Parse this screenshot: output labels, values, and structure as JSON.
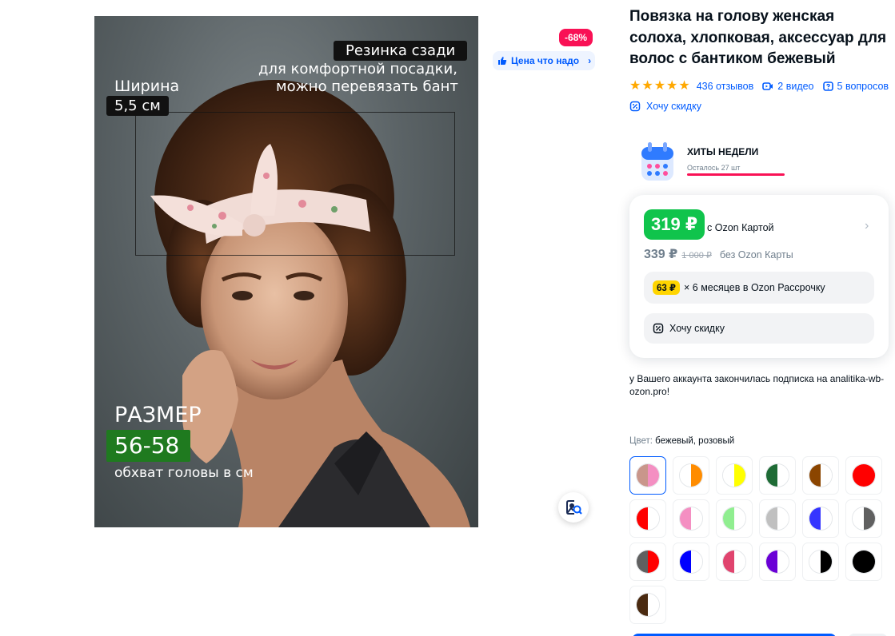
{
  "image": {
    "overlay": {
      "width_label": "Ширина",
      "width_value": "5,5 см",
      "back_tag": "Резинка сзади",
      "back_caption_line1": "для комфортной посадки,",
      "back_caption_line2": "можно перевязать бант",
      "size_title": "РАЗМЕР",
      "size_value": "56-58",
      "size_caption": "обхват головы в см"
    },
    "discount_badge": "-68%",
    "price_chip": "Цена что надо",
    "lens_icon": "image-search-icon"
  },
  "product": {
    "title": "Повязка на голову женская солоха, хлопковая, аксессуар для волос с бантиком бежевый",
    "rating_stars": 5,
    "reviews": "436 отзывов",
    "videos": "2 видео",
    "questions": "5 вопросов",
    "want_discount": "Хочу скидку"
  },
  "hits": {
    "title": "ХИТЫ НЕДЕЛИ",
    "left": "Осталось 27 шт"
  },
  "price_card": {
    "card_price": "319 ₽",
    "card_label": "с Ozon Картой",
    "price": "339 ₽",
    "old_price": "1 000 ₽",
    "price_note": "без Ozon Карты",
    "installment_chip": "63 ₽",
    "installment_text": "× 6 месяцев в Ozon Рассрочку",
    "want_discount": "Хочу скидку"
  },
  "notice": "у Вашего аккаунта закончилась подписка на analitika-wb-ozon.pro!",
  "colors": {
    "label": "Цвет:",
    "selected": "бежевый, розовый",
    "swatches": [
      {
        "l": "#c9968b",
        "r": "#f48fc2"
      },
      {
        "l": "#ffffff",
        "r": "#ff8c00"
      },
      {
        "l": "#ffffff",
        "r": "#ffff00"
      },
      {
        "l": "#1e6b35",
        "r": "#ffffff"
      },
      {
        "l": "#8b4500",
        "r": "#ffffff"
      },
      {
        "l": "#ff0000",
        "r": "#ff0000"
      },
      {
        "l": "#ff0000",
        "r": "#ffffff"
      },
      {
        "l": "#f48fc2",
        "r": "#ffffff"
      },
      {
        "l": "#90ee90",
        "r": "#ffffff"
      },
      {
        "l": "#c0c0c0",
        "r": "#ffffff"
      },
      {
        "l": "#3535ff",
        "r": "#ffffff"
      },
      {
        "l": "#ffffff",
        "r": "#606060"
      },
      {
        "l": "#606060",
        "r": "#ff0000"
      },
      {
        "l": "#0000ff",
        "r": "#ffffff"
      },
      {
        "l": "#e0446e",
        "r": "#ffffff"
      },
      {
        "l": "#6a00d6",
        "r": "#ffffff"
      },
      {
        "l": "#ffffff",
        "r": "#000000"
      },
      {
        "l": "#000000",
        "r": "#000000"
      },
      {
        "l": "#4a2a10",
        "r": "#ffffff"
      }
    ]
  }
}
